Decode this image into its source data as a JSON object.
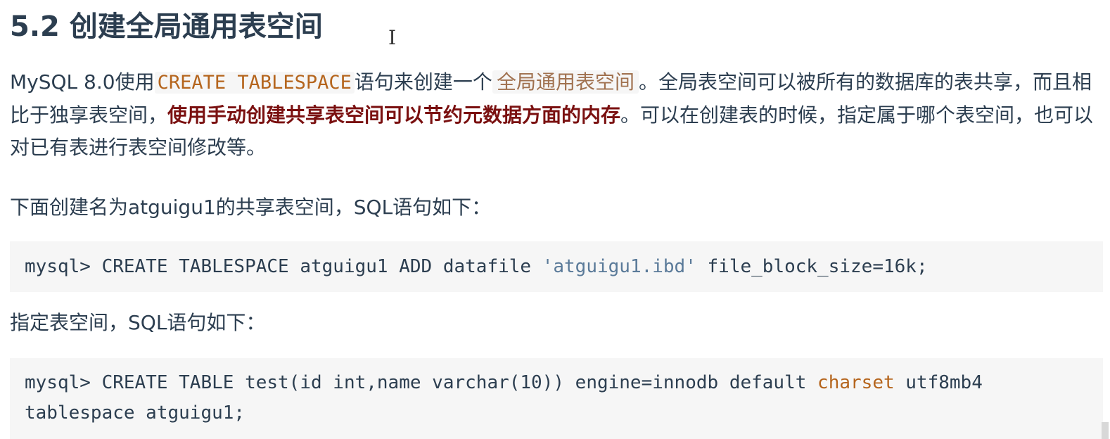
{
  "heading": "5.2 创建全局通用表空间",
  "cursor_glyph": "I",
  "para1": {
    "t1": "MySQL 8.0使用",
    "code": "CREATE TABLESPACE",
    "t2": "语句来创建一个",
    "link": "全局通用表空间",
    "t3": "。全局表空间可以被所有的数据库的表共享，而且相比于独享表空间，",
    "bold": "使用手动创建共享表空间可以节约元数据方面的内存",
    "t4": "。可以在创建表的时候，指定属于哪个表空间，也可以对已有表进行表空间修改等。"
  },
  "para2": "下面创建名为atguigu1的共享表空间，SQL语句如下：",
  "code1": {
    "pre": "mysql> CREATE TABLESPACE atguigu1 ADD datafile ",
    "str": "'atguigu1.ibd'",
    "post": " file_block_size=16k;"
  },
  "para3": "指定表空间，SQL语句如下：",
  "code2": {
    "l1_pre": "mysql> CREATE TABLE test(id int,name varchar(10)) engine=innodb default ",
    "l1_kw": "charset",
    "l1_post": " utf8mb4",
    "l2": "tablespace atguigu1;"
  },
  "colors": {
    "text": "#2c3e50",
    "inline_code": "#b5651d",
    "emphasis": "#7a1010",
    "string": "#5a7a99",
    "code_bg": "#f6f6f6"
  }
}
